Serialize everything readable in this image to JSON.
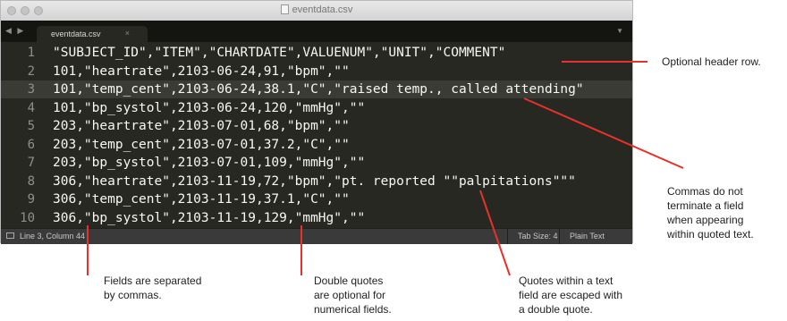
{
  "window": {
    "title": "eventdata.csv",
    "tab_label": "eventdata.csv",
    "tab_close": "×",
    "nav_arrows": "◀ ▶",
    "tab_menu": "▼"
  },
  "editor": {
    "lines": [
      {
        "num": "1",
        "text": "\"SUBJECT_ID\",\"ITEM\",\"CHARTDATE\",VALUENUM\",\"UNIT\",\"COMMENT\""
      },
      {
        "num": "2",
        "text": "101,\"heartrate\",2103-06-24,91,\"bpm\",\"\""
      },
      {
        "num": "3",
        "text": "101,\"temp_cent\",2103-06-24,38.1,\"C\",\"raised temp., called attending\""
      },
      {
        "num": "4",
        "text": "101,\"bp_systol\",2103-06-24,120,\"mmHg\",\"\""
      },
      {
        "num": "5",
        "text": "203,\"heartrate\",2103-07-01,68,\"bpm\",\"\""
      },
      {
        "num": "6",
        "text": "203,\"temp_cent\",2103-07-01,37.2,\"C\",\"\""
      },
      {
        "num": "7",
        "text": "203,\"bp_systol\",2103-07-01,109,\"mmHg\",\"\""
      },
      {
        "num": "8",
        "text": "306,\"heartrate\",2103-11-19,72,\"bpm\",\"pt. reported \"\"palpitations\"\"\""
      },
      {
        "num": "9",
        "text": "306,\"temp_cent\",2103-11-19,37.1,\"C\",\"\""
      },
      {
        "num": "10",
        "text": "306,\"bp_systol\",2103-11-19,129,\"mmHg\",\"\""
      }
    ],
    "active_line": 3
  },
  "status": {
    "position": "Line 3, Column 44",
    "tab_size": "Tab Size: 4",
    "syntax": "Plain Text"
  },
  "annotations": {
    "header_row": "Optional header row.",
    "commas_quoted": [
      "Commas do not",
      "terminate a field",
      "when appearing",
      "within quoted text."
    ],
    "separated": [
      "Fields are separated",
      "by commas."
    ],
    "double_quotes": [
      "Double quotes",
      "are optional for",
      "numerical fields."
    ],
    "escaped": [
      "Quotes within a text",
      "field are escaped with",
      "a double quote."
    ]
  },
  "colors": {
    "editor_bg": "#272822",
    "text": "#f8f8f2",
    "arrow": "#e8312a"
  }
}
